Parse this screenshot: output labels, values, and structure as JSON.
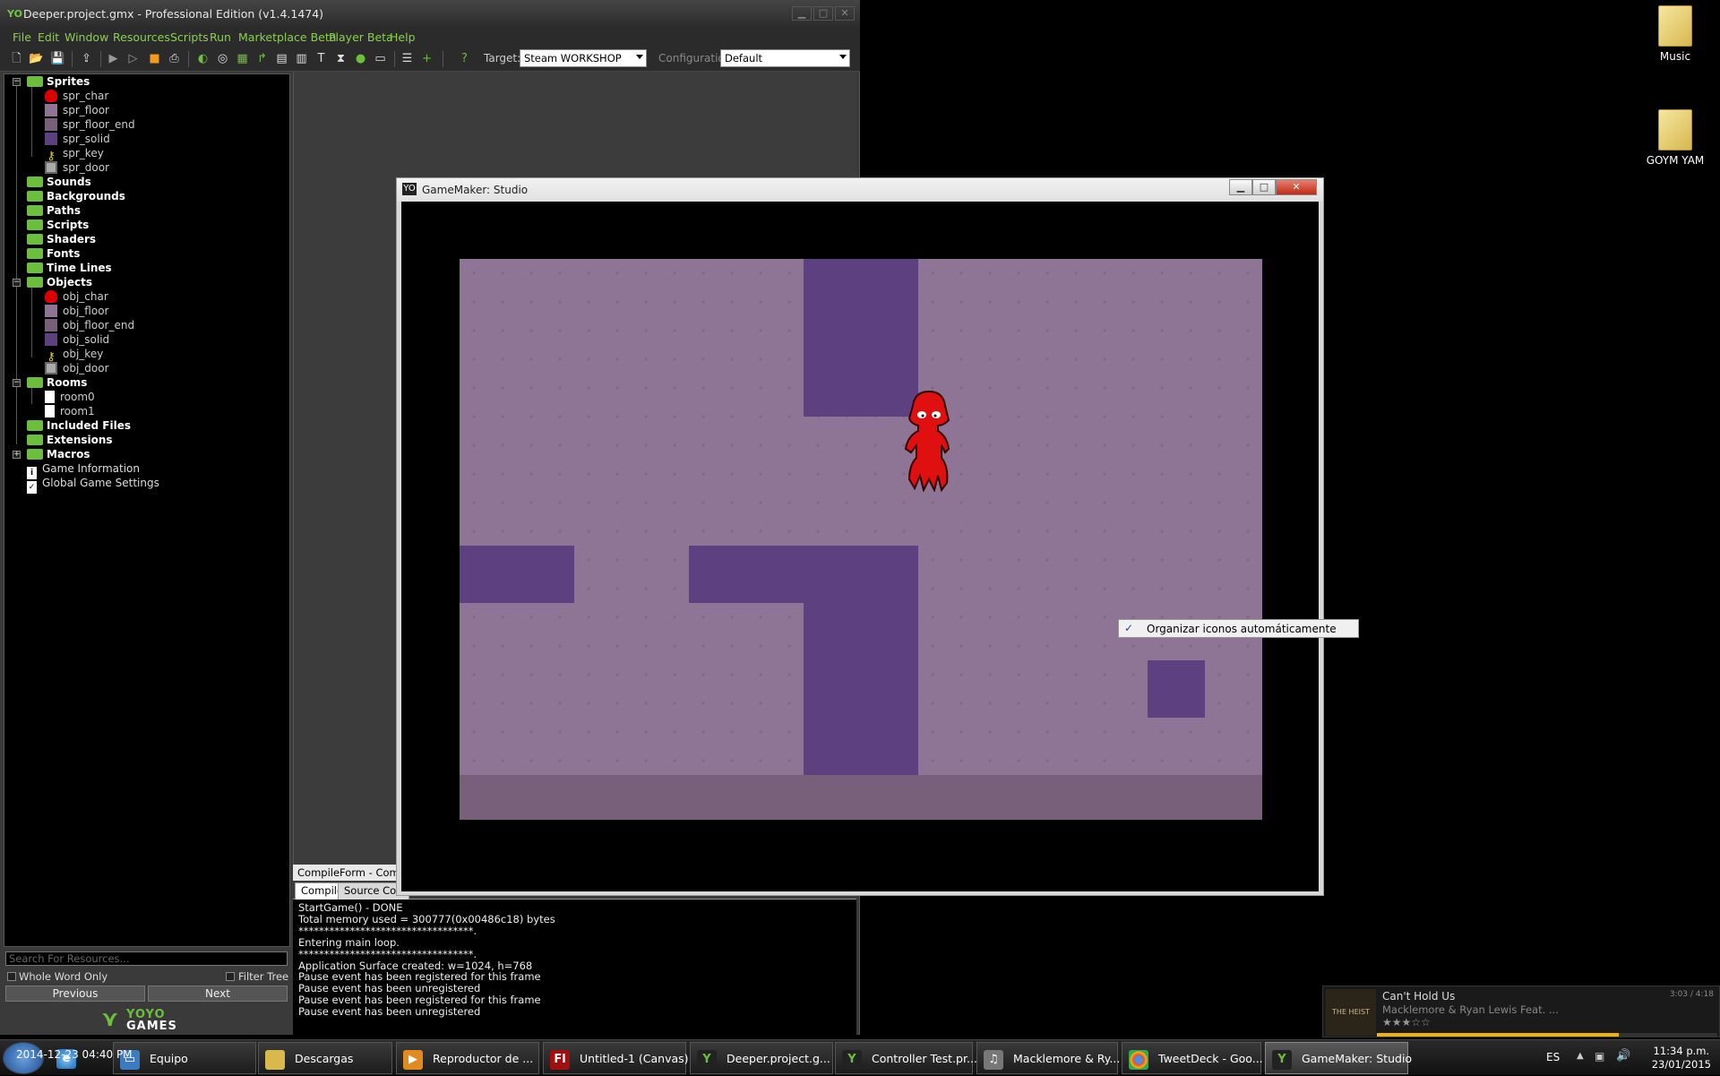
{
  "ide": {
    "title": "Deeper.project.gmx  -  Professional Edition (v1.4.1474)",
    "menu": [
      "File",
      "Edit",
      "Window",
      "Resources",
      "Scripts",
      "Run",
      "Marketplace Beta",
      "Player Beta",
      "Help"
    ],
    "target_label": "Target:",
    "target_value": "Steam WORKSHOP",
    "config_label": "Configuration:",
    "config_value": "Default",
    "tree": {
      "sprites": "Sprites",
      "sprite_items": [
        "spr_char",
        "spr_floor",
        "spr_floor_end",
        "spr_solid",
        "spr_key",
        "spr_door"
      ],
      "sounds": "Sounds",
      "backgrounds": "Backgrounds",
      "paths": "Paths",
      "scripts": "Scripts",
      "shaders": "Shaders",
      "fonts": "Fonts",
      "timelines": "Time Lines",
      "objects": "Objects",
      "object_items": [
        "obj_char",
        "obj_floor",
        "obj_floor_end",
        "obj_solid",
        "obj_key",
        "obj_door"
      ],
      "rooms": "Rooms",
      "room_items": [
        "room0",
        "room1"
      ],
      "included_files": "Included Files",
      "extensions": "Extensions",
      "macros": "Macros",
      "game_information": "Game Information",
      "global_settings": "Global Game Settings"
    },
    "search_placeholder": "Search For Resources...",
    "whole_word": "Whole Word Only",
    "filter_tree": "Filter Tree",
    "previous": "Previous",
    "next": "Next",
    "logo_top": "YOYO",
    "logo_bottom": "GAMES"
  },
  "compile": {
    "title": "CompileForm - Compile",
    "tab_compile": "Compile",
    "tab_source": "Source Con",
    "log": [
      "StartGame() - DONE",
      "Total memory used = 300777(0x00486c18) bytes",
      "**********************************.",
      "Entering main loop.",
      "**********************************.",
      "Application Surface created: w=1024, h=768",
      "Pause event has been registered for this frame",
      "Pause event has been unregistered",
      "Pause event has been registered for this frame",
      "Pause event has been unregistered"
    ]
  },
  "game_window": {
    "title": "GameMaker: Studio",
    "context_menu_item": "Organizar iconos automáticamente"
  },
  "desktop": {
    "icons": [
      "Music",
      "GOYM YAM"
    ]
  },
  "media": {
    "song": "Can't Hold Us",
    "artist": "Macklemore & Ryan Lewis Feat. ...",
    "time": "3:03 / 4:18",
    "album_text": "THE HEIST",
    "rating": 3,
    "progress": 0.71
  },
  "taskbar": {
    "overlay": "2014-12-23 04:40 PM",
    "buttons": [
      {
        "label": "Equipo",
        "icon": "computer-icon"
      },
      {
        "label": "Descargas",
        "icon": "folder-icon"
      },
      {
        "label": "Reproductor de ...",
        "icon": "media-player-icon"
      },
      {
        "label": "Untitled-1 (Canvas)",
        "icon": "flash-icon"
      },
      {
        "label": "Deeper.project.g...",
        "icon": "gamemaker-icon"
      },
      {
        "label": "Controller Test.pr...",
        "icon": "gamemaker-icon"
      },
      {
        "label": "Macklemore & Ry...",
        "icon": "winamp-icon"
      },
      {
        "label": "TweetDeck - Goo...",
        "icon": "chrome-icon"
      },
      {
        "label": "GameMaker: Studio",
        "icon": "gamemaker-icon"
      }
    ],
    "lang": "ES",
    "time": "11:34 p.m.",
    "date": "23/01/2015"
  },
  "colors": {
    "accent_green": "#6cbf3c",
    "room_floor": "#8e7596",
    "solid": "#5c4080",
    "character": "#e01010"
  }
}
